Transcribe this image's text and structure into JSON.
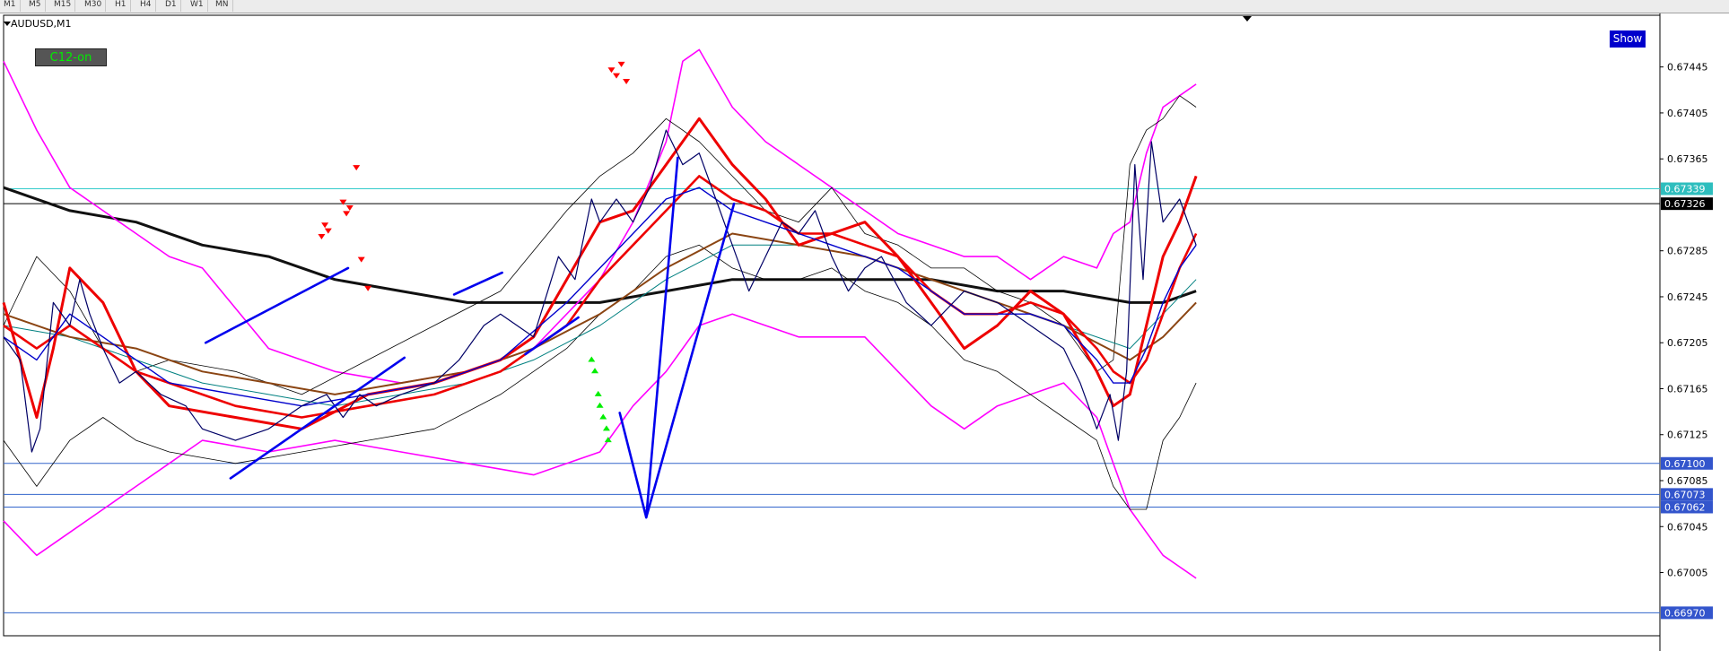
{
  "window": {
    "symbol": "AUDUSD,M1",
    "timeframes": [
      "M1",
      "M5",
      "M15",
      "M30",
      "H1",
      "H4",
      "D1",
      "W1",
      "MN"
    ]
  },
  "indicator_badge": "C12-on",
  "show_button": "Show",
  "colors": {
    "price": "#000066",
    "bollinger_outer": "#ff00ff",
    "bollinger_inner": "#000000",
    "ma_red": "#ee0000",
    "ma_blue": "#0000cc",
    "ma_brown": "#8b4513",
    "ma_teal": "#008080",
    "ma_long": "#111111",
    "trend_lines": "#0000ee",
    "signal_sell": "#ff0000",
    "signal_buy": "#00ee00",
    "hline_blue": "#3366cc",
    "hline_cyan": "#33cccc",
    "hline_black": "#000000",
    "grid": "none"
  },
  "chart_data": {
    "type": "line",
    "instrument": "AUDUSD",
    "timeframe": "M1",
    "ylim": [
      0.6695,
      0.6749
    ],
    "x_range": [
      0,
      1000
    ],
    "y_ticks": [
      "0.67445",
      "0.67405",
      "0.67365",
      "0.67285",
      "0.67245",
      "0.67205",
      "0.67165",
      "0.67125",
      "0.67085",
      "0.67045",
      "0.67005"
    ],
    "price_labels": [
      {
        "text": "0.67339",
        "value": 0.67339,
        "style": "cyan"
      },
      {
        "text": "0.67326",
        "value": 0.67326,
        "style": "black"
      },
      {
        "text": "0.67100",
        "value": 0.671,
        "style": "blue"
      },
      {
        "text": "0.67073",
        "value": 0.67073,
        "style": "blue"
      },
      {
        "text": "0.67062",
        "value": 0.67062,
        "style": "blue"
      },
      {
        "text": "0.66970",
        "value": 0.6697,
        "style": "blue"
      }
    ],
    "hlines": [
      {
        "value": 0.67339,
        "style": "cyan"
      },
      {
        "value": 0.67326,
        "style": "black"
      },
      {
        "value": 0.671,
        "style": "blue"
      },
      {
        "value": 0.67073,
        "style": "blue"
      },
      {
        "value": 0.67062,
        "style": "blue"
      },
      {
        "value": 0.6697,
        "style": "blue"
      }
    ],
    "series": [
      {
        "role": "price",
        "x": [
          0,
          10,
          17,
          22,
          30,
          40,
          46,
          52,
          60,
          70,
          80,
          95,
          110,
          120,
          140,
          160,
          180,
          195,
          205,
          215,
          225,
          240,
          260,
          275,
          290,
          300,
          320,
          335,
          345,
          355,
          360,
          370,
          380,
          390,
          400,
          410,
          420,
          430,
          440,
          450,
          460,
          470,
          480,
          490,
          500,
          510,
          520,
          530,
          545,
          560,
          580,
          600,
          620,
          640,
          650,
          660,
          668,
          673,
          678,
          683,
          688,
          693,
          700,
          710,
          720
        ],
        "y": [
          0.6721,
          0.6719,
          0.6711,
          0.6713,
          0.6724,
          0.6722,
          0.6726,
          0.6723,
          0.672,
          0.6717,
          0.6718,
          0.6716,
          0.6715,
          0.6713,
          0.6712,
          0.6713,
          0.6715,
          0.6716,
          0.6714,
          0.6716,
          0.6715,
          0.6716,
          0.6717,
          0.6719,
          0.6722,
          0.6723,
          0.6721,
          0.6728,
          0.6726,
          0.6733,
          0.6731,
          0.6733,
          0.6731,
          0.6734,
          0.6739,
          0.6736,
          0.6737,
          0.6733,
          0.6729,
          0.6725,
          0.6728,
          0.6731,
          0.673,
          0.6732,
          0.6728,
          0.6725,
          0.6727,
          0.6728,
          0.6724,
          0.6722,
          0.6725,
          0.6724,
          0.6722,
          0.672,
          0.6717,
          0.6713,
          0.6716,
          0.6712,
          0.6718,
          0.6736,
          0.6726,
          0.6738,
          0.6731,
          0.6733,
          0.6729
        ]
      },
      {
        "role": "bollinger_outer_upper",
        "x": [
          0,
          20,
          40,
          60,
          80,
          100,
          120,
          160,
          200,
          240,
          280,
          320,
          360,
          380,
          400,
          410,
          420,
          440,
          460,
          480,
          500,
          520,
          540,
          560,
          580,
          600,
          620,
          640,
          660,
          670,
          680,
          690,
          700,
          710,
          720
        ],
        "y": [
          0.6745,
          0.6739,
          0.6734,
          0.6732,
          0.673,
          0.6728,
          0.6727,
          0.672,
          0.6718,
          0.6717,
          0.6718,
          0.672,
          0.6726,
          0.6731,
          0.6738,
          0.6745,
          0.6746,
          0.6741,
          0.6738,
          0.6736,
          0.6734,
          0.6732,
          0.673,
          0.6729,
          0.6728,
          0.6728,
          0.6726,
          0.6728,
          0.6727,
          0.673,
          0.6731,
          0.6737,
          0.6741,
          0.6742,
          0.6743
        ]
      },
      {
        "role": "bollinger_outer_lower",
        "x": [
          0,
          20,
          40,
          60,
          80,
          100,
          120,
          160,
          200,
          240,
          280,
          320,
          360,
          380,
          400,
          410,
          420,
          440,
          460,
          480,
          500,
          520,
          540,
          560,
          580,
          600,
          620,
          640,
          660,
          670,
          680,
          690,
          700,
          710,
          720
        ],
        "y": [
          0.6705,
          0.6702,
          0.6704,
          0.6706,
          0.6708,
          0.671,
          0.6712,
          0.6711,
          0.6712,
          0.6711,
          0.671,
          0.6709,
          0.6711,
          0.6715,
          0.6718,
          0.672,
          0.6722,
          0.6723,
          0.6722,
          0.6721,
          0.6721,
          0.6721,
          0.6718,
          0.6715,
          0.6713,
          0.6715,
          0.6716,
          0.6717,
          0.6714,
          0.671,
          0.6706,
          0.6704,
          0.6702,
          0.6701,
          0.67
        ]
      },
      {
        "role": "bollinger_inner_upper",
        "x": [
          0,
          20,
          40,
          60,
          80,
          100,
          140,
          180,
          220,
          260,
          300,
          340,
          360,
          380,
          400,
          420,
          440,
          460,
          480,
          500,
          520,
          540,
          560,
          580,
          600,
          620,
          640,
          660,
          670,
          680,
          690,
          700,
          710,
          720
        ],
        "y": [
          0.6722,
          0.6728,
          0.6725,
          0.672,
          0.6718,
          0.6719,
          0.6718,
          0.6716,
          0.6719,
          0.6722,
          0.6725,
          0.6732,
          0.6735,
          0.6737,
          0.674,
          0.6738,
          0.6735,
          0.6732,
          0.6731,
          0.6734,
          0.673,
          0.6729,
          0.6727,
          0.6727,
          0.6725,
          0.6724,
          0.6722,
          0.6718,
          0.6719,
          0.6736,
          0.6739,
          0.674,
          0.6742,
          0.6741
        ]
      },
      {
        "role": "bollinger_inner_lower",
        "x": [
          0,
          20,
          40,
          60,
          80,
          100,
          140,
          180,
          220,
          260,
          300,
          340,
          360,
          380,
          400,
          420,
          440,
          460,
          480,
          500,
          520,
          540,
          560,
          580,
          600,
          620,
          640,
          660,
          670,
          680,
          690,
          700,
          710,
          720
        ],
        "y": [
          0.6712,
          0.6708,
          0.6712,
          0.6714,
          0.6712,
          0.6711,
          0.671,
          0.6711,
          0.6712,
          0.6713,
          0.6716,
          0.672,
          0.6723,
          0.6725,
          0.6728,
          0.6729,
          0.6727,
          0.6726,
          0.6726,
          0.6727,
          0.6725,
          0.6724,
          0.6722,
          0.6719,
          0.6718,
          0.6716,
          0.6714,
          0.6712,
          0.6708,
          0.6706,
          0.6706,
          0.6712,
          0.6714,
          0.6717
        ]
      },
      {
        "role": "ma_red_fast",
        "x": [
          0,
          20,
          30,
          40,
          60,
          80,
          100,
          140,
          180,
          220,
          260,
          300,
          320,
          340,
          360,
          380,
          400,
          420,
          440,
          460,
          480,
          500,
          520,
          540,
          560,
          580,
          600,
          620,
          640,
          660,
          670,
          680,
          690,
          700,
          710,
          720
        ],
        "y": [
          0.6724,
          0.6714,
          0.672,
          0.6727,
          0.6724,
          0.6718,
          0.6715,
          0.6714,
          0.6713,
          0.6716,
          0.6717,
          0.6719,
          0.6721,
          0.6726,
          0.6731,
          0.6732,
          0.6736,
          0.674,
          0.6736,
          0.6733,
          0.6729,
          0.673,
          0.6731,
          0.6728,
          0.6724,
          0.672,
          0.6722,
          0.6725,
          0.6723,
          0.6718,
          0.6715,
          0.6716,
          0.6722,
          0.6728,
          0.6731,
          0.6735
        ]
      },
      {
        "role": "ma_red_slow",
        "x": [
          0,
          20,
          40,
          60,
          80,
          100,
          140,
          180,
          220,
          260,
          300,
          340,
          360,
          380,
          400,
          420,
          440,
          460,
          480,
          500,
          520,
          540,
          560,
          580,
          600,
          620,
          640,
          660,
          670,
          680,
          690,
          700,
          710,
          720
        ],
        "y": [
          0.6722,
          0.672,
          0.6722,
          0.672,
          0.6718,
          0.6717,
          0.6715,
          0.6714,
          0.6715,
          0.6716,
          0.6718,
          0.6722,
          0.6726,
          0.6729,
          0.6732,
          0.6735,
          0.6733,
          0.6732,
          0.673,
          0.673,
          0.6729,
          0.6728,
          0.6725,
          0.6723,
          0.6723,
          0.6724,
          0.6723,
          0.672,
          0.6718,
          0.6717,
          0.6719,
          0.6723,
          0.6727,
          0.673
        ]
      },
      {
        "role": "ma_blue",
        "x": [
          0,
          20,
          40,
          60,
          80,
          100,
          140,
          180,
          220,
          260,
          300,
          340,
          360,
          380,
          400,
          420,
          440,
          460,
          480,
          500,
          520,
          540,
          560,
          580,
          600,
          620,
          640,
          660,
          670,
          680,
          690,
          700,
          710,
          720
        ],
        "y": [
          0.6721,
          0.6719,
          0.6723,
          0.6721,
          0.6719,
          0.6717,
          0.6716,
          0.6715,
          0.6716,
          0.6717,
          0.6719,
          0.6724,
          0.6727,
          0.673,
          0.6733,
          0.6734,
          0.6732,
          0.6731,
          0.673,
          0.6729,
          0.6728,
          0.6727,
          0.6725,
          0.6723,
          0.6723,
          0.6723,
          0.6722,
          0.6719,
          0.6717,
          0.6717,
          0.672,
          0.6724,
          0.6727,
          0.6729
        ]
      },
      {
        "role": "ma_brown",
        "x": [
          0,
          40,
          80,
          120,
          160,
          200,
          240,
          280,
          320,
          360,
          400,
          440,
          480,
          520,
          560,
          600,
          640,
          680,
          700,
          720
        ],
        "y": [
          0.6723,
          0.6721,
          0.672,
          0.6718,
          0.6717,
          0.6716,
          0.6717,
          0.6718,
          0.672,
          0.6723,
          0.6727,
          0.673,
          0.6729,
          0.6728,
          0.6726,
          0.6724,
          0.6722,
          0.6719,
          0.6721,
          0.6724
        ]
      },
      {
        "role": "ma_teal",
        "x": [
          0,
          40,
          80,
          120,
          160,
          200,
          240,
          280,
          320,
          360,
          400,
          440,
          480,
          520,
          560,
          600,
          640,
          680,
          700,
          720
        ],
        "y": [
          0.6722,
          0.6721,
          0.6719,
          0.6717,
          0.6716,
          0.6715,
          0.6716,
          0.6717,
          0.6719,
          0.6722,
          0.6726,
          0.6729,
          0.6729,
          0.6728,
          0.6726,
          0.6724,
          0.6722,
          0.672,
          0.6723,
          0.6726
        ]
      },
      {
        "role": "ma_long",
        "x": [
          0,
          40,
          80,
          120,
          160,
          200,
          240,
          280,
          320,
          360,
          400,
          440,
          480,
          520,
          560,
          600,
          640,
          680,
          700,
          720
        ],
        "y": [
          0.6734,
          0.6732,
          0.6731,
          0.6729,
          0.6728,
          0.6726,
          0.6725,
          0.6724,
          0.6724,
          0.6724,
          0.6725,
          0.6726,
          0.6726,
          0.6726,
          0.6726,
          0.6725,
          0.6725,
          0.6724,
          0.6724,
          0.6725
        ]
      }
    ],
    "trend_lines": [
      {
        "x": [
          122,
          208
        ],
        "y": [
          0.67205,
          0.6727
        ]
      },
      {
        "x": [
          137,
          242
        ],
        "y": [
          0.67087,
          0.67192
        ]
      },
      {
        "x": [
          272,
          301
        ],
        "y": [
          0.67247,
          0.67266
        ]
      },
      {
        "x": [
          315,
          347
        ],
        "y": [
          0.67195,
          0.67227
        ]
      },
      {
        "x": [
          372,
          388
        ],
        "y": [
          0.67144,
          0.67053
        ]
      },
      {
        "x": [
          388,
          407
        ],
        "y": [
          0.67053,
          0.67366
        ]
      },
      {
        "x": [
          388,
          441
        ],
        "y": [
          0.67053,
          0.67326
        ]
      }
    ],
    "signals": {
      "sell_x": [
        192,
        194,
        196,
        205,
        207,
        209,
        213,
        216,
        220,
        367,
        370,
        373,
        376
      ],
      "sell_y": [
        0.67298,
        0.67308,
        0.67303,
        0.67328,
        0.67318,
        0.67323,
        0.67358,
        0.67278,
        0.67253,
        0.67443,
        0.67438,
        0.67448,
        0.67433
      ],
      "buy_x": [
        355,
        357,
        359,
        360,
        362,
        364,
        365
      ],
      "buy_y": [
        0.6719,
        0.6718,
        0.6716,
        0.6715,
        0.6714,
        0.6713,
        0.6712
      ]
    }
  }
}
